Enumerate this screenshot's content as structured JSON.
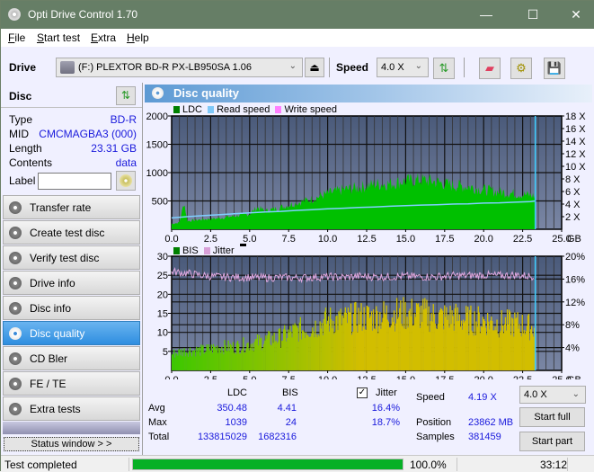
{
  "window": {
    "title": "Opti Drive Control 1.70",
    "minimize": "—",
    "maximize": "☐",
    "close": "✕"
  },
  "menu": [
    {
      "label": "File",
      "key": "F",
      "rest": "ile"
    },
    {
      "label": "Start test",
      "key": "S",
      "rest": "tart test"
    },
    {
      "label": "Extra",
      "key": "E",
      "rest": "xtra"
    },
    {
      "label": "Help",
      "key": "H",
      "rest": "elp"
    }
  ],
  "toolbar": {
    "drive_label": "Drive",
    "drive_value": "(F:)  PLEXTOR BD-R  PX-LB950SA 1.06",
    "speed_label": "Speed",
    "speed_value": "4.0 X"
  },
  "disc": {
    "header": "Disc",
    "fields": [
      {
        "label": "Type",
        "value": "BD-R"
      },
      {
        "label": "MID",
        "value": "CMCMAGBA3 (000)"
      },
      {
        "label": "Length",
        "value": "23.31 GB"
      },
      {
        "label": "Contents",
        "value": "data"
      }
    ],
    "label_field": "Label",
    "label_value": ""
  },
  "nav": [
    {
      "label": "Transfer rate",
      "active": false
    },
    {
      "label": "Create test disc",
      "active": false
    },
    {
      "label": "Verify test disc",
      "active": false
    },
    {
      "label": "Drive info",
      "active": false
    },
    {
      "label": "Disc info",
      "active": false
    },
    {
      "label": "Disc quality",
      "active": true
    },
    {
      "label": "CD Bler",
      "active": false
    },
    {
      "label": "FE / TE",
      "active": false
    },
    {
      "label": "Extra tests",
      "active": false
    }
  ],
  "status_window_button": "Status window > >",
  "panel": {
    "title": "Disc quality"
  },
  "chart_data": [
    {
      "type": "area",
      "title": "LDC",
      "legend": [
        {
          "name": "LDC",
          "color": "#008000"
        },
        {
          "name": "Read speed",
          "color": "#7fc8f8"
        },
        {
          "name": "Write speed",
          "color": "#ff80ff"
        }
      ],
      "x_ticks": [
        "0.0",
        "2.5",
        "5.0",
        "7.5",
        "10.0",
        "12.5",
        "15.0",
        "17.5",
        "20.0",
        "22.5",
        "25.0"
      ],
      "x_unit": "GB",
      "xlim": [
        0,
        25
      ],
      "y_ticks": [
        "500",
        "1000",
        "1500",
        "2000"
      ],
      "ylim": [
        0,
        2000
      ],
      "y2_ticks": [
        "2 X",
        "4 X",
        "6 X",
        "8 X",
        "10 X",
        "12 X",
        "14 X",
        "16 X",
        "18 X"
      ],
      "y2lim": [
        0,
        18
      ],
      "end_marker_gb": 23.31,
      "series": [
        {
          "name": "LDC",
          "x": [
            0,
            0.5,
            0.8,
            1.0,
            2.0,
            3.0,
            4.0,
            5.0,
            5.5,
            6.0,
            7.0,
            8.0,
            9.0,
            10.0,
            11.0,
            12.0,
            13.0,
            14.0,
            15.0,
            16.0,
            17.0,
            18.0,
            19.0,
            20.0,
            21.0,
            22.0,
            23.0,
            23.31
          ],
          "values": [
            100,
            120,
            500,
            150,
            180,
            200,
            240,
            280,
            400,
            330,
            400,
            480,
            550,
            650,
            720,
            760,
            820,
            830,
            880,
            900,
            860,
            800,
            780,
            720,
            680,
            650,
            620,
            600
          ]
        },
        {
          "name": "Read speed",
          "x": [
            0,
            1,
            2,
            3,
            4,
            5,
            6,
            7,
            8,
            9,
            10,
            11,
            12,
            13,
            14,
            15,
            16,
            17,
            18,
            19,
            20,
            21,
            22,
            23,
            23.31
          ],
          "values": [
            1.8,
            2.0,
            2.15,
            2.3,
            2.45,
            2.6,
            2.75,
            2.85,
            3.0,
            3.1,
            3.25,
            3.35,
            3.45,
            3.55,
            3.65,
            3.75,
            3.85,
            3.9,
            4.0,
            4.05,
            4.15,
            4.2,
            4.3,
            4.4,
            4.5
          ]
        }
      ]
    },
    {
      "type": "bar",
      "title": "BIS",
      "legend": [
        {
          "name": "BIS",
          "color": "#008000"
        },
        {
          "name": "Jitter",
          "color": "#d8a0d8"
        }
      ],
      "x_ticks": [
        "0.0",
        "2.5",
        "5.0",
        "7.5",
        "10.0",
        "12.5",
        "15.0",
        "17.5",
        "20.0",
        "22.5",
        "25.0"
      ],
      "x_unit": "GB",
      "xlim": [
        0,
        25
      ],
      "y_ticks": [
        "5",
        "10",
        "15",
        "20",
        "25",
        "30"
      ],
      "ylim": [
        0,
        30
      ],
      "y2_ticks": [
        "4%",
        "8%",
        "12%",
        "16%",
        "20%"
      ],
      "y2lim": [
        0,
        20
      ],
      "end_marker_gb": 23.31,
      "series": [
        {
          "name": "BIS",
          "x": [
            0,
            1,
            2,
            3,
            4,
            5,
            6,
            7,
            8,
            9,
            10,
            11,
            12,
            13,
            14,
            15,
            16,
            17,
            18,
            19,
            20,
            21,
            22,
            23,
            23.31
          ],
          "values": [
            5,
            6,
            6,
            7,
            7,
            8,
            9,
            10,
            12,
            13,
            15,
            15,
            16,
            16,
            17,
            17,
            17,
            16,
            16,
            15,
            15,
            14,
            14,
            13,
            13
          ]
        },
        {
          "name": "Jitter",
          "x": [
            0,
            1,
            2,
            3,
            4,
            5,
            6,
            7,
            8,
            9,
            10,
            11,
            12,
            13,
            14,
            15,
            16,
            17,
            18,
            19,
            20,
            21,
            22,
            23,
            23.31
          ],
          "values": [
            17.3,
            17.0,
            16.6,
            16.4,
            16.3,
            16.3,
            16.2,
            16.3,
            16.2,
            16.3,
            16.4,
            16.3,
            16.5,
            16.4,
            16.4,
            16.5,
            16.4,
            16.4,
            16.6,
            16.6,
            16.7,
            16.6,
            16.7,
            16.5,
            16.6
          ]
        }
      ]
    }
  ],
  "stats": {
    "col_ldc": "LDC",
    "col_bis": "BIS",
    "jitter_label": "Jitter",
    "jitter_checked": true,
    "rows": [
      {
        "label": "Avg",
        "ldc": "350.48",
        "bis": "4.41",
        "jitter": "16.4%"
      },
      {
        "label": "Max",
        "ldc": "1039",
        "bis": "24",
        "jitter": "18.7%"
      },
      {
        "label": "Total",
        "ldc": "133815029",
        "bis": "1682316",
        "jitter": ""
      }
    ],
    "speed_label": "Speed",
    "speed_value": "4.19 X",
    "position_label": "Position",
    "position_value": "23862 MB",
    "samples_label": "Samples",
    "samples_value": "381459",
    "speed_select": "4.0 X",
    "start_full": "Start full",
    "start_part": "Start part"
  },
  "statusbar": {
    "text": "Test completed",
    "progress": 1.0,
    "percent": "100.0%",
    "time": "33:12"
  }
}
